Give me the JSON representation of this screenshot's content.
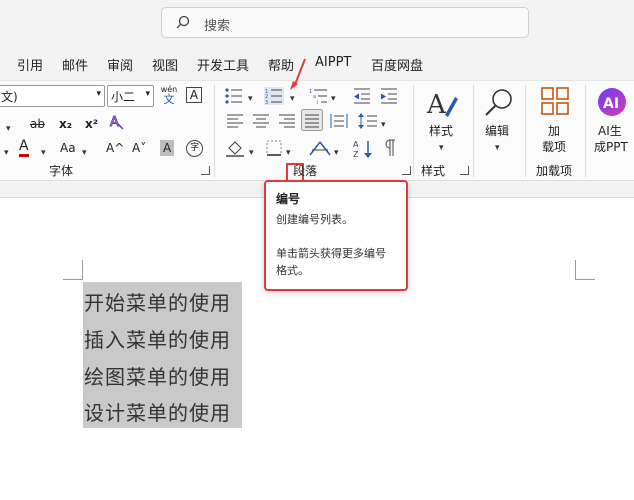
{
  "search": {
    "placeholder": "搜索"
  },
  "tabs": [
    "引用",
    "邮件",
    "审阅",
    "视图",
    "开发工具",
    "帮助",
    "AIPPT",
    "百度网盘"
  ],
  "font": {
    "name": "文)",
    "size": "小二",
    "wen": "wén",
    "wen2": "文",
    "box_a": "A",
    "strike": "ab",
    "sub": "x₂",
    "sup": "x²",
    "color_a": "A",
    "case": "Aa",
    "grow": "A^",
    "shrink": "A˅",
    "shade_a": "A",
    "circle": "字"
  },
  "groups": {
    "font_label": "字体",
    "paragraph_label": "段落",
    "styles_label": "样式",
    "addins_label": "加载项"
  },
  "big_buttons": {
    "styles": "样式",
    "edit": "编辑",
    "addins_line1": "加",
    "addins_line2": "载项",
    "ai_line1": "AI生",
    "ai_line2": "成PPT"
  },
  "tooltip": {
    "title": "编号",
    "line1": "创建编号列表。",
    "line2": "单击箭头获得更多编号",
    "line3": "格式。"
  },
  "document": {
    "lines": [
      "开始菜单的使用",
      "插入菜单的使用",
      "绘图菜单的使用",
      "设计菜单的使用"
    ]
  },
  "colors": {
    "highlight": "#e23b3b",
    "selection": "#c9c9c9",
    "accent": "#c55a11"
  }
}
